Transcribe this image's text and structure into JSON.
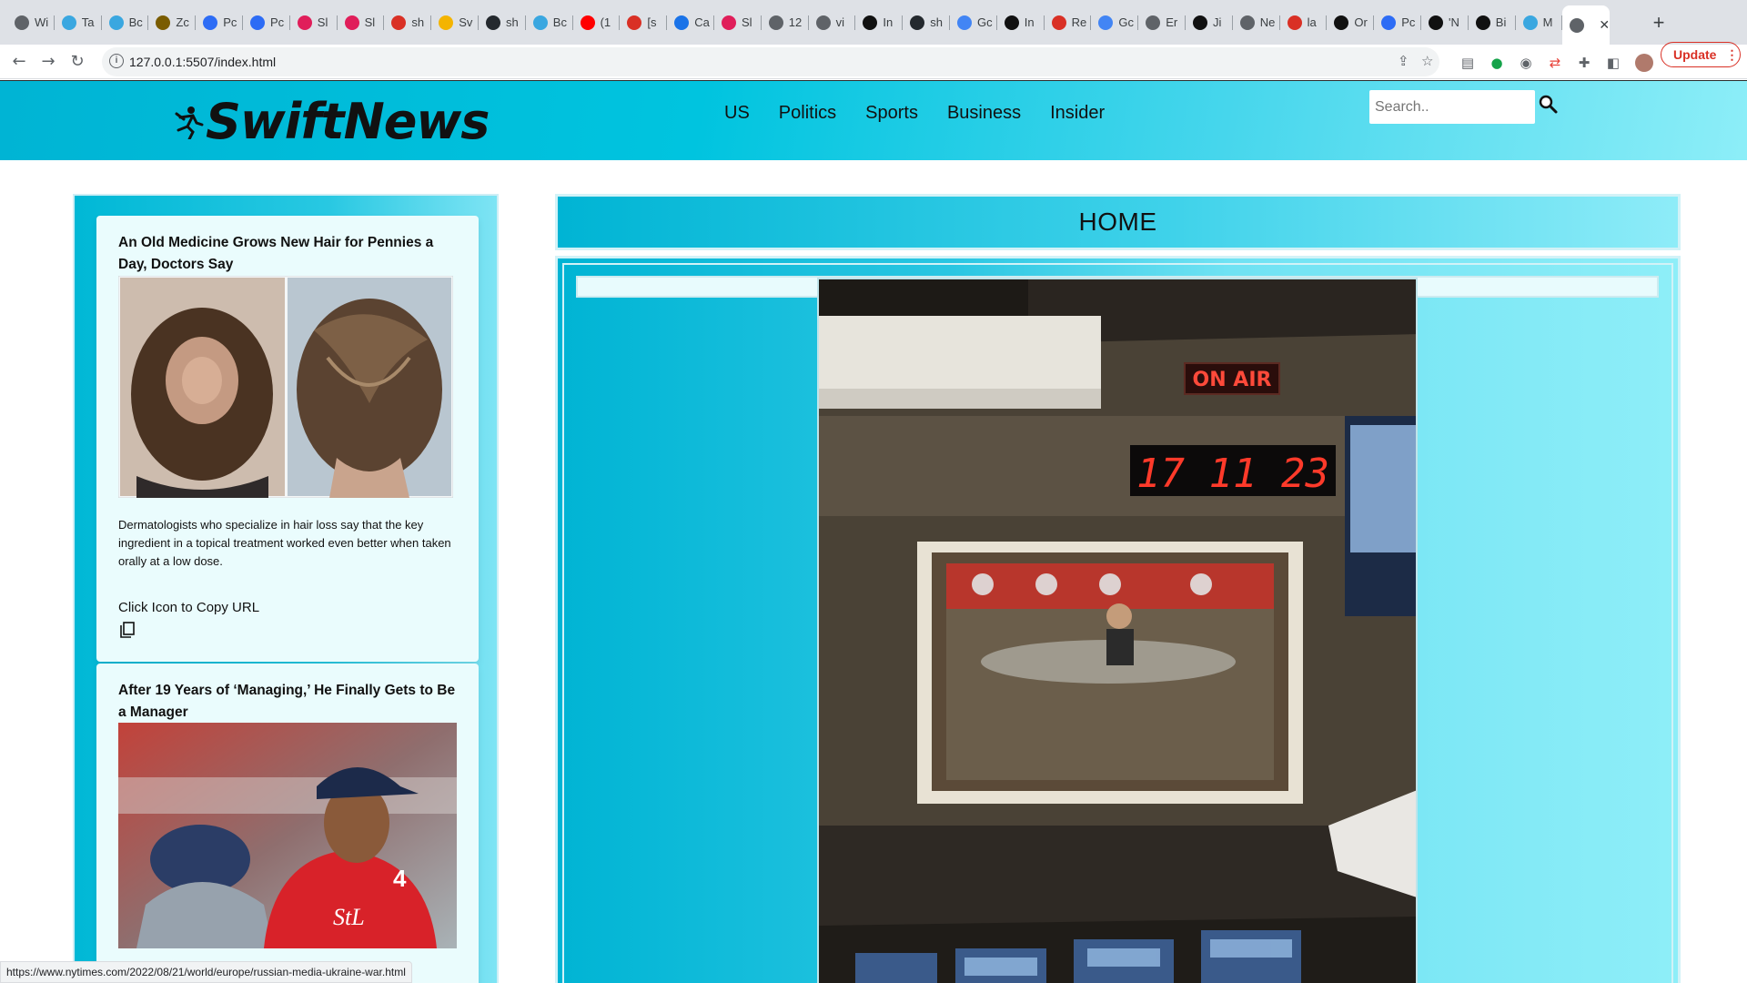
{
  "browser": {
    "tabs": [
      {
        "label": "Wi",
        "favicon": "globe-icon",
        "color": "#5f6368"
      },
      {
        "label": "Ta",
        "favicon": "wave-icon",
        "color": "#3aa7e0"
      },
      {
        "label": "Bc",
        "favicon": "wave-icon",
        "color": "#3aa7e0"
      },
      {
        "label": "Zc",
        "favicon": "bee-icon",
        "color": "#7a5c00"
      },
      {
        "label": "Pc",
        "favicon": "chat-icon",
        "color": "#2d6cf5"
      },
      {
        "label": "Pc",
        "favicon": "chat-icon",
        "color": "#2d6cf5"
      },
      {
        "label": "Sl",
        "favicon": "slack-icon",
        "color": "#e01e5a"
      },
      {
        "label": "Sl",
        "favicon": "slack-icon",
        "color": "#e01e5a"
      },
      {
        "label": "sh",
        "favicon": "gmail-icon",
        "color": "#d93025"
      },
      {
        "label": "Sv",
        "favicon": "slides-icon",
        "color": "#f4b400"
      },
      {
        "label": "sh",
        "favicon": "github-icon",
        "color": "#24292e"
      },
      {
        "label": "Bc",
        "favicon": "wave-icon",
        "color": "#3aa7e0"
      },
      {
        "label": "(1",
        "favicon": "youtube-icon",
        "color": "#ff0000"
      },
      {
        "label": "[s",
        "favicon": "gmail-icon",
        "color": "#d93025"
      },
      {
        "label": "Ca",
        "favicon": "circle-icon",
        "color": "#1a73e8"
      },
      {
        "label": "Sl",
        "favicon": "slack-icon",
        "color": "#e01e5a"
      },
      {
        "label": "12",
        "favicon": "globe-icon",
        "color": "#5f6368"
      },
      {
        "label": "vi",
        "favicon": "globe-icon",
        "color": "#5f6368"
      },
      {
        "label": "In",
        "favicon": "nyt-icon",
        "color": "#111111"
      },
      {
        "label": "sh",
        "favicon": "github-icon",
        "color": "#24292e"
      },
      {
        "label": "Gc",
        "favicon": "google-icon",
        "color": "#4285f4"
      },
      {
        "label": "In",
        "favicon": "nyt-icon",
        "color": "#111111"
      },
      {
        "label": "Re",
        "favicon": "gmail-icon",
        "color": "#d93025"
      },
      {
        "label": "Gc",
        "favicon": "google-icon",
        "color": "#4285f4"
      },
      {
        "label": "Er",
        "favicon": "globe-icon",
        "color": "#5f6368"
      },
      {
        "label": "Ji",
        "favicon": "nyt-icon",
        "color": "#111111"
      },
      {
        "label": "Ne",
        "favicon": "globe-icon",
        "color": "#5f6368"
      },
      {
        "label": "la",
        "favicon": "gmail-icon",
        "color": "#d93025"
      },
      {
        "label": "Or",
        "favicon": "nyt-icon",
        "color": "#111111"
      },
      {
        "label": "Pc",
        "favicon": "chat-icon",
        "color": "#2d6cf5"
      },
      {
        "label": "'N",
        "favicon": "nyt-icon",
        "color": "#111111"
      },
      {
        "label": "Bi",
        "favicon": "nyt-icon",
        "color": "#111111"
      },
      {
        "label": "M",
        "favicon": "wave-icon",
        "color": "#3aa7e0"
      }
    ],
    "url": "127.0.0.1:5507/index.html",
    "update_label": "Update",
    "status_url": "https://www.nytimes.com/2022/08/21/world/europe/russian-media-ukraine-war.html"
  },
  "site": {
    "logo": "SwiftNews",
    "nav": [
      "US",
      "Politics",
      "Sports",
      "Business",
      "Insider"
    ],
    "search_placeholder": "Search..",
    "accent": "#00c4df"
  },
  "sidebar": {
    "articles": [
      {
        "title": "An Old Medicine Grows New Hair for Pennies a Day, Doctors Say",
        "description": "Dermatologists who specialize in hair loss say that the key ingredient in a topical treatment worked even better when taken orally at a low dose.",
        "copy_label": "Click Icon to Copy URL"
      },
      {
        "title": "After 19 Years of ‘Managing,’ He Finally Gets to Be a Manager"
      }
    ]
  },
  "main": {
    "heading": "HOME",
    "hero": {
      "sign": "ON AIR",
      "clock": "17 11 23"
    }
  }
}
